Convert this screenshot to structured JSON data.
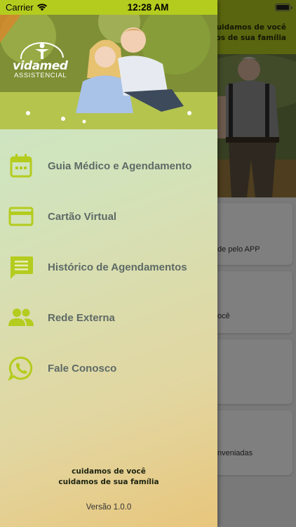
{
  "status_bar": {
    "carrier": "Carrier",
    "time": "12:28 AM",
    "icons": [
      "wifi-icon",
      "battery-icon"
    ]
  },
  "background_app": {
    "slogan_line1": "cuidamos de você",
    "slogan_line2": "mos de sua família",
    "cards": [
      {
        "text": "de pelo APP"
      },
      {
        "text": "ocê"
      },
      {
        "text": ""
      },
      {
        "text": "nveniadas"
      }
    ]
  },
  "drawer": {
    "logo_name": "vidamed",
    "logo_sub": "ASSISTENCIAL",
    "menu": [
      {
        "label": "Guia Médico e Agendamento",
        "icon": "calendar-icon"
      },
      {
        "label": "Cartão Virtual",
        "icon": "credit-card-icon"
      },
      {
        "label": "Histórico de Agendamentos",
        "icon": "message-icon"
      },
      {
        "label": "Rede Externa",
        "icon": "people-icon"
      },
      {
        "label": "Fale Conosco",
        "icon": "whatsapp-icon"
      }
    ],
    "slogan_line1": "cuidamos de você",
    "slogan_line2": "cuidamos de sua família",
    "version": "Versão 1.0.0"
  },
  "colors": {
    "brand_green": "#b4cc1e",
    "menu_text": "#5e6a66",
    "icon": "#b4cc1e"
  }
}
